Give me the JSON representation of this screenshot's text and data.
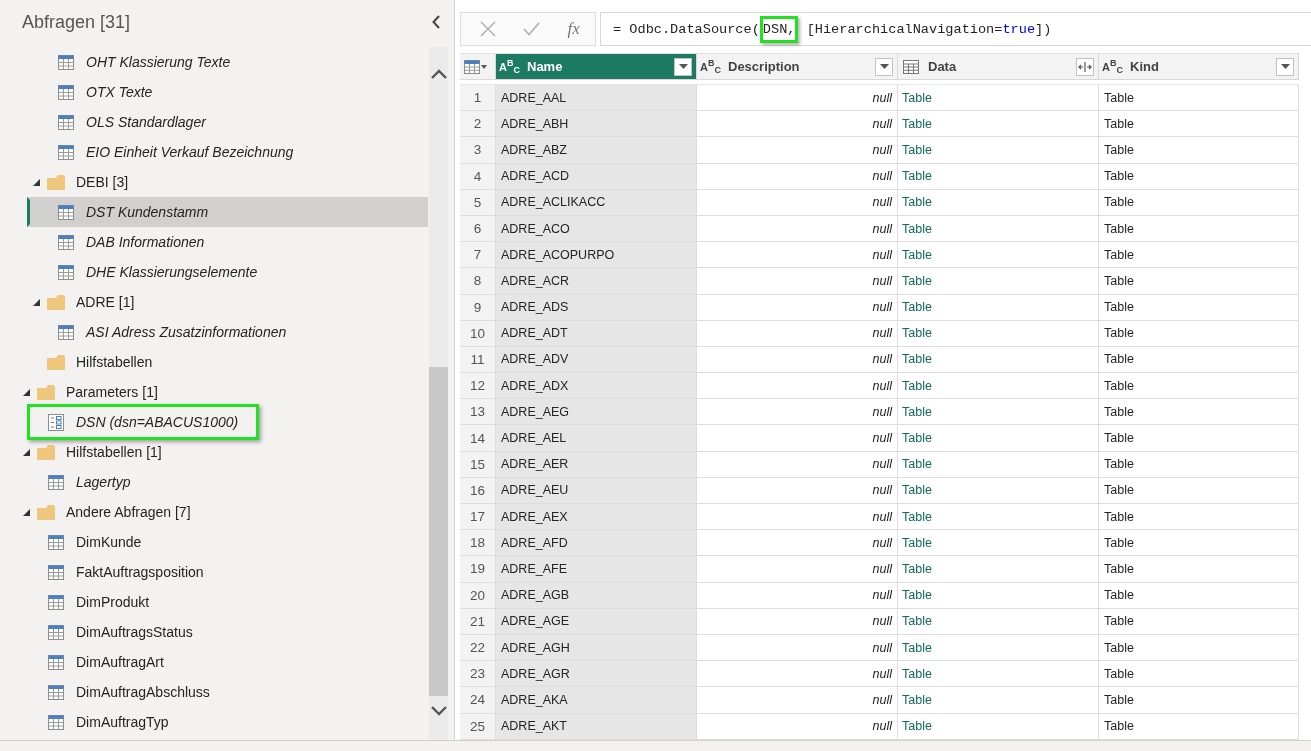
{
  "queries_panel": {
    "title": "Abfragen [31]",
    "tree": [
      {
        "children": [
          {
            "children": [
              {
                "kind": "table",
                "label": "OHT Klassierung Texte",
                "load_disabled": true,
                "selected": false,
                "highlighted": false
              },
              {
                "kind": "table",
                "label": "OTX Texte",
                "load_disabled": true,
                "selected": false,
                "highlighted": false
              },
              {
                "kind": "table",
                "label": "OLS Standardlager",
                "load_disabled": true,
                "selected": false,
                "highlighted": false
              },
              {
                "kind": "table",
                "label": "EIO Einheit Verkauf Bezeichnung",
                "load_disabled": true,
                "selected": false,
                "highlighted": false
              }
            ]
          },
          {
            "kind": "folder",
            "label": "DEBI [3]",
            "expanded": true,
            "children": [
              {
                "kind": "table",
                "label": "DST Kundenstamm",
                "load_disabled": true,
                "selected": true,
                "highlighted": false
              },
              {
                "kind": "table",
                "label": "DAB Informationen",
                "load_disabled": true,
                "selected": false,
                "highlighted": false
              },
              {
                "kind": "table",
                "label": "DHE Klassierungselemente",
                "load_disabled": true,
                "selected": false,
                "highlighted": false
              }
            ]
          },
          {
            "kind": "folder",
            "label": "ADRE [1]",
            "expanded": true,
            "children": [
              {
                "kind": "table",
                "label": "ASI Adress Zusatzinformationen",
                "load_disabled": true,
                "selected": false,
                "highlighted": false
              }
            ]
          },
          {
            "kind": "folder",
            "label": "Hilfstabellen"
          }
        ]
      },
      {
        "kind": "folder",
        "label": "Parameters [1]",
        "expanded": true,
        "children": [
          {
            "kind": "parameter",
            "label": "DSN (dsn=ABACUS1000)",
            "load_disabled": true,
            "selected": false,
            "highlighted": true
          }
        ]
      },
      {
        "kind": "folder",
        "label": "Hilfstabellen [1]",
        "expanded": true,
        "children": [
          {
            "kind": "table",
            "label": "Lagertyp",
            "load_disabled": true,
            "selected": false,
            "highlighted": false
          }
        ]
      },
      {
        "kind": "folder",
        "label": "Andere Abfragen [7]",
        "expanded": true,
        "children": [
          {
            "kind": "table",
            "label": "DimKunde",
            "load_disabled": false,
            "selected": false,
            "highlighted": false
          },
          {
            "kind": "table",
            "label": "FaktAuftragsposition",
            "load_disabled": false,
            "selected": false,
            "highlighted": false
          },
          {
            "kind": "table",
            "label": "DimProdukt",
            "load_disabled": false,
            "selected": false,
            "highlighted": false
          },
          {
            "kind": "table",
            "label": "DimAuftragsStatus",
            "load_disabled": false,
            "selected": false,
            "highlighted": false
          },
          {
            "kind": "table",
            "label": "DimAuftragArt",
            "load_disabled": false,
            "selected": false,
            "highlighted": false
          },
          {
            "kind": "table",
            "label": "DimAuftragAbschluss",
            "load_disabled": false,
            "selected": false,
            "highlighted": false
          },
          {
            "kind": "table",
            "label": "DimAuftragTyp",
            "load_disabled": false,
            "selected": false,
            "highlighted": false
          }
        ]
      }
    ]
  },
  "formula_bar": {
    "buttons": [
      {
        "kind": "cancel",
        "disabled": true
      },
      {
        "kind": "commit",
        "disabled": true
      },
      {
        "kind": "insert_function",
        "label": "fx"
      }
    ],
    "formula": [
      {
        "text": "= Odbc.DataSource(",
        "kind": "plain",
        "highlighted": false
      },
      {
        "text": "DSN,",
        "kind": "plain",
        "highlighted": true
      },
      {
        "text": " [HierarchicalNavigation=",
        "kind": "plain",
        "highlighted": false
      },
      {
        "text": "true",
        "kind": "keyword",
        "highlighted": false
      },
      {
        "text": "])",
        "kind": "plain",
        "highlighted": false
      }
    ]
  },
  "table": {
    "columns": [
      {
        "label": "Name",
        "kind": "text",
        "type_label": "A$^{B}$$_{C}$",
        "selected": true,
        "null_values": false
      },
      {
        "label": "Description",
        "kind": "text",
        "type_label": "A$^{B}$$_{C}$",
        "selected": false,
        "null_values": true
      },
      {
        "label": "Data",
        "kind": "table",
        "selected": false,
        "null_values": false
      },
      {
        "label": "Kind",
        "kind": "text",
        "type_label": "A$^{B}$$_{C}$",
        "selected": false,
        "null_values": false
      }
    ],
    "rows": [
      {
        "number": "1",
        "cells": [
          "ADRE_AAL",
          "null",
          "Table",
          "Table"
        ]
      },
      {
        "number": "2",
        "cells": [
          "ADRE_ABH",
          "null",
          "Table",
          "Table"
        ]
      },
      {
        "number": "3",
        "cells": [
          "ADRE_ABZ",
          "null",
          "Table",
          "Table"
        ]
      },
      {
        "number": "4",
        "cells": [
          "ADRE_ACD",
          "null",
          "Table",
          "Table"
        ]
      },
      {
        "number": "5",
        "cells": [
          "ADRE_ACLIKACC",
          "null",
          "Table",
          "Table"
        ]
      },
      {
        "number": "6",
        "cells": [
          "ADRE_ACO",
          "null",
          "Table",
          "Table"
        ]
      },
      {
        "number": "7",
        "cells": [
          "ADRE_ACOPURPO",
          "null",
          "Table",
          "Table"
        ]
      },
      {
        "number": "8",
        "cells": [
          "ADRE_ACR",
          "null",
          "Table",
          "Table"
        ]
      },
      {
        "number": "9",
        "cells": [
          "ADRE_ADS",
          "null",
          "Table",
          "Table"
        ]
      },
      {
        "number": "10",
        "cells": [
          "ADRE_ADT",
          "null",
          "Table",
          "Table"
        ]
      },
      {
        "number": "11",
        "cells": [
          "ADRE_ADV",
          "null",
          "Table",
          "Table"
        ]
      },
      {
        "number": "12",
        "cells": [
          "ADRE_ADX",
          "null",
          "Table",
          "Table"
        ]
      },
      {
        "number": "13",
        "cells": [
          "ADRE_AEG",
          "null",
          "Table",
          "Table"
        ]
      },
      {
        "number": "14",
        "cells": [
          "ADRE_AEL",
          "null",
          "Table",
          "Table"
        ]
      },
      {
        "number": "15",
        "cells": [
          "ADRE_AER",
          "null",
          "Table",
          "Table"
        ]
      },
      {
        "number": "16",
        "cells": [
          "ADRE_AEU",
          "null",
          "Table",
          "Table"
        ]
      },
      {
        "number": "17",
        "cells": [
          "ADRE_AEX",
          "null",
          "Table",
          "Table"
        ]
      },
      {
        "number": "18",
        "cells": [
          "ADRE_AFD",
          "null",
          "Table",
          "Table"
        ]
      },
      {
        "number": "19",
        "cells": [
          "ADRE_AFE",
          "null",
          "Table",
          "Table"
        ]
      },
      {
        "number": "20",
        "cells": [
          "ADRE_AGB",
          "null",
          "Table",
          "Table"
        ]
      },
      {
        "number": "21",
        "cells": [
          "ADRE_AGE",
          "null",
          "Table",
          "Table"
        ]
      },
      {
        "number": "22",
        "cells": [
          "ADRE_AGH",
          "null",
          "Table",
          "Table"
        ]
      },
      {
        "number": "23",
        "cells": [
          "ADRE_AGR",
          "null",
          "Table",
          "Table"
        ]
      },
      {
        "number": "24",
        "cells": [
          "ADRE_AKA",
          "null",
          "Table",
          "Table"
        ]
      },
      {
        "number": "25",
        "cells": [
          "ADRE_AKT",
          "null",
          "Table",
          "Table"
        ]
      }
    ]
  }
}
